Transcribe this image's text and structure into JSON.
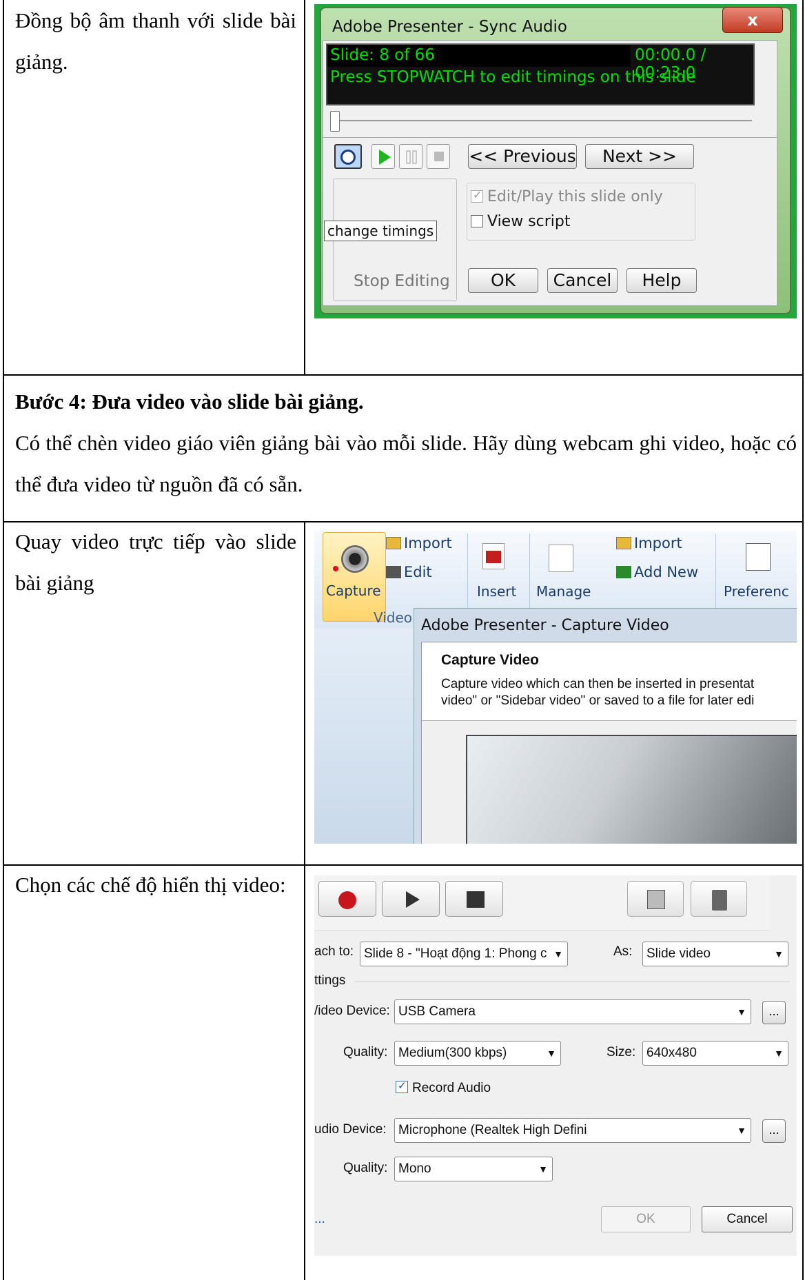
{
  "row1": {
    "left_text": "Đồng bộ âm thanh với slide bài giảng.",
    "dialog": {
      "title": "Adobe Presenter - Sync Audio",
      "close_glyph": "x",
      "slide_counter": "Slide: 8 of 66",
      "time": "00:00.0 / 00:23.0",
      "instruction": "Press STOPWATCH to edit timings on this slide",
      "prev_label": "<< Previous",
      "next_label": "Next >>",
      "tooltip": "change timings",
      "edit_play_label": "Edit/Play this slide only",
      "edit_play_checked": true,
      "view_script_label": "View script",
      "view_script_checked": false,
      "stop_editing_label": "Stop Editing",
      "ok_label": "OK",
      "cancel_label": "Cancel",
      "help_label": "Help"
    }
  },
  "step4": {
    "heading": "Bước 4: Đưa video vào slide bài giảng.",
    "body": "Có thể chèn video giáo viên giảng bài vào mỗi slide. Hãy dùng webcam ghi video, hoặc có thể đưa video từ nguồn đã có sẵn."
  },
  "row3": {
    "left_text": "Quay video trực tiếp vào slide bài giảng",
    "ribbon": {
      "capture_label": "Capture",
      "import_label": "Import",
      "edit_label": "Edit",
      "insert_label": "Insert",
      "manage_label": "Manage",
      "import2_label": "Import",
      "add_new_label": "Add New",
      "preferences_label": "Preferenc",
      "group_label": "Video"
    },
    "capture_dialog": {
      "title": "Adobe Presenter - Capture Video",
      "heading": "Capture Video",
      "desc_line1": "Capture video which can then be inserted in presentat",
      "desc_line2": "video\" or \"Sidebar video\" or saved to a file for later edi"
    }
  },
  "row4": {
    "left_text": "Chọn các chế độ hiển thị video:",
    "settings": {
      "attach_label": "ach to:",
      "attach_value": "Slide 8 - \"Hoạt động 1: Phong c",
      "as_label": "As:",
      "as_value": "Slide video",
      "section_label": "ttings",
      "video_device_label": "/ideo Device:",
      "video_device_value": "USB Camera",
      "quality_label": "Quality:",
      "quality_value": "Medium(300 kbps)",
      "size_label": "Size:",
      "size_value": "640x480",
      "record_audio_label": "Record Audio",
      "record_audio_checked": true,
      "audio_device_label": "udio Device:",
      "audio_device_value": "Microphone (Realtek High Defini",
      "audio_quality_label": "Quality:",
      "audio_quality_value": "Mono",
      "more_btn": "...",
      "link_text": "...",
      "ok_label": "OK",
      "cancel_label": "Cancel"
    }
  }
}
